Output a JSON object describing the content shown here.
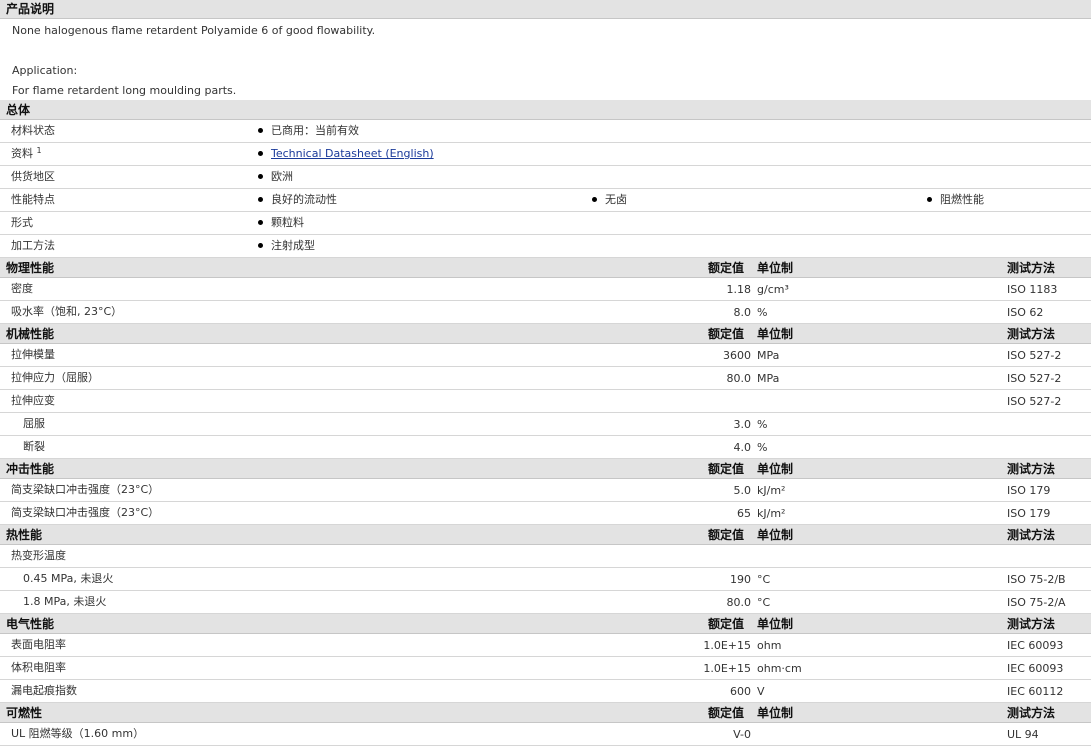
{
  "product_desc": {
    "header": "产品说明",
    "line1": "None halogenous flame retardent Polyamide 6 of good flowability.",
    "app_label": "Application:",
    "app_text": "For flame retardent long moulding parts."
  },
  "general": {
    "header": "总体",
    "rows": [
      {
        "label": "材料状态",
        "items": [
          "已商用：当前有效"
        ]
      },
      {
        "label": "资料",
        "sup": "1",
        "items": [
          "Technical Datasheet (English)"
        ],
        "link": true
      },
      {
        "label": "供货地区",
        "items": [
          "欧洲"
        ]
      },
      {
        "label": "性能特点",
        "items": [
          "良好的流动性",
          "无卤",
          "阻燃性能"
        ]
      },
      {
        "label": "形式",
        "items": [
          "颗粒料"
        ]
      },
      {
        "label": "加工方法",
        "items": [
          "注射成型"
        ]
      }
    ]
  },
  "columns": {
    "value": "额定值",
    "unit": "单位制",
    "method": "测试方法"
  },
  "sections": [
    {
      "header": "物理性能",
      "rows": [
        {
          "label": "密度",
          "value": "1.18",
          "unit": "g/cm³",
          "method": "ISO 1183",
          "indent": 0
        },
        {
          "label": "吸水率（饱和, 23°C）",
          "value": "8.0",
          "unit": "%",
          "method": "ISO 62",
          "indent": 0
        }
      ]
    },
    {
      "header": "机械性能",
      "rows": [
        {
          "label": "拉伸模量",
          "value": "3600",
          "unit": "MPa",
          "method": "ISO 527-2",
          "indent": 0
        },
        {
          "label": "拉伸应力（屈服）",
          "value": "80.0",
          "unit": "MPa",
          "method": "ISO 527-2",
          "indent": 0
        },
        {
          "label": "拉伸应变",
          "value": "",
          "unit": "",
          "method": "ISO 527-2",
          "indent": 0
        },
        {
          "label": "屈服",
          "value": "3.0",
          "unit": "%",
          "method": "",
          "indent": 1
        },
        {
          "label": "断裂",
          "value": "4.0",
          "unit": "%",
          "method": "",
          "indent": 1
        }
      ]
    },
    {
      "header": "冲击性能",
      "rows": [
        {
          "label": "简支梁缺口冲击强度（23°C）",
          "value": "5.0",
          "unit": "kJ/m²",
          "method": "ISO 179",
          "indent": 0
        },
        {
          "label": "简支梁缺口冲击强度（23°C）",
          "value": "65",
          "unit": "kJ/m²",
          "method": "ISO 179",
          "indent": 0
        }
      ]
    },
    {
      "header": "热性能",
      "rows": [
        {
          "label": "热变形温度",
          "value": "",
          "unit": "",
          "method": "",
          "indent": 0
        },
        {
          "label": "0.45 MPa, 未退火",
          "value": "190",
          "unit": "°C",
          "method": "ISO 75-2/B",
          "indent": 1
        },
        {
          "label": "1.8 MPa, 未退火",
          "value": "80.0",
          "unit": "°C",
          "method": "ISO 75-2/A",
          "indent": 1
        }
      ]
    },
    {
      "header": "电气性能",
      "rows": [
        {
          "label": "表面电阻率",
          "value": "1.0E+15",
          "unit": "ohm",
          "method": "IEC 60093",
          "indent": 0
        },
        {
          "label": "体积电阻率",
          "value": "1.0E+15",
          "unit": "ohm·cm",
          "method": "IEC 60093",
          "indent": 0
        },
        {
          "label": "漏电起痕指数",
          "value": "600",
          "unit": "V",
          "method": "IEC 60112",
          "indent": 0
        }
      ]
    },
    {
      "header": "可燃性",
      "rows": [
        {
          "label": "UL 阻燃等级（1.60 mm）",
          "value": "V-0",
          "unit": "",
          "method": "UL 94",
          "indent": 0
        }
      ]
    }
  ]
}
